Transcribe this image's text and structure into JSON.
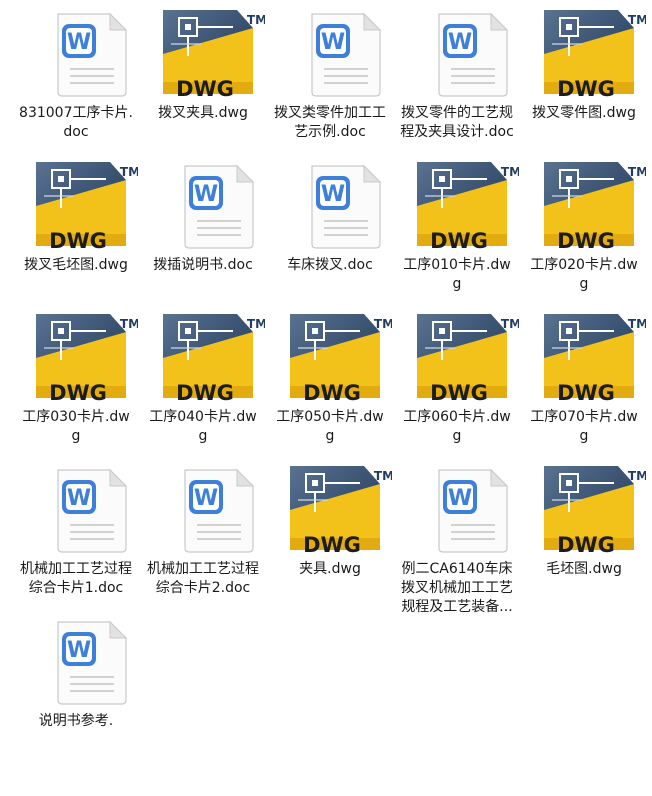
{
  "files": [
    {
      "name": "831007工序卡片.doc",
      "type": "doc"
    },
    {
      "name": "拨叉夹具.dwg",
      "type": "dwg"
    },
    {
      "name": "拨叉类零件加工工艺示例.doc",
      "type": "doc"
    },
    {
      "name": "拨叉零件的工艺规程及夹具设计.doc",
      "type": "doc"
    },
    {
      "name": "拨叉零件图.dwg",
      "type": "dwg"
    },
    {
      "name": "拨叉毛坯图.dwg",
      "type": "dwg"
    },
    {
      "name": "拨插说明书.doc",
      "type": "doc"
    },
    {
      "name": "车床拨叉.doc",
      "type": "doc"
    },
    {
      "name": "工序010卡片.dwg",
      "type": "dwg"
    },
    {
      "name": "工序020卡片.dwg",
      "type": "dwg"
    },
    {
      "name": "工序030卡片.dwg",
      "type": "dwg"
    },
    {
      "name": "工序040卡片.dwg",
      "type": "dwg"
    },
    {
      "name": "工序050卡片.dwg",
      "type": "dwg"
    },
    {
      "name": "工序060卡片.dwg",
      "type": "dwg"
    },
    {
      "name": "工序070卡片.dwg",
      "type": "dwg"
    },
    {
      "name": "机械加工工艺过程综合卡片1.doc",
      "type": "doc"
    },
    {
      "name": "机械加工工艺过程综合卡片2.doc",
      "type": "doc"
    },
    {
      "name": "夹具.dwg",
      "type": "dwg"
    },
    {
      "name": "例二CA6140车床拨叉机械加工工艺规程及工艺装备...",
      "type": "doc"
    },
    {
      "name": "毛坯图.dwg",
      "type": "dwg"
    },
    {
      "name": "说明书参考.",
      "type": "doc"
    }
  ],
  "dwg_icon": {
    "badge": "DWG",
    "trademark": "TM"
  },
  "doc_icon": {
    "glyph": "W"
  },
  "colors": {
    "doc_blue": "#3d7fd9",
    "dwg_yellow": "#f2c21a",
    "dwg_navy": "#233d62",
    "label_text": "#1a1a1a"
  }
}
